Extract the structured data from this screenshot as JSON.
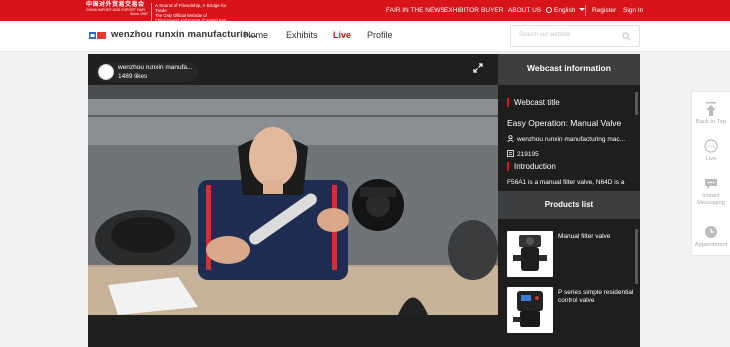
{
  "topbar": {
    "logo_zh": "中国对外贸易交易会",
    "logo_en": "CHINA IMPORT AND EXPORT FAIR",
    "logo_since": "Since 1957",
    "slogan_1": "A Sound of Friendship, A Bridge for Trade",
    "slogan_2": "The Only Official Website of",
    "slogan_3": "China Import and Export (Canton) Fair",
    "nav": [
      "FAIR IN THE NEWS",
      "EXHIBITOR",
      "BUYER",
      "ABOUT US"
    ],
    "language": "English",
    "register": "Register",
    "sign_in": "Sign In"
  },
  "navbar": {
    "company_name": "wenzhou runxin manufacturin...",
    "links": [
      "Home",
      "Exhibits",
      "Live",
      "Profile"
    ],
    "active": "Live",
    "search_placeholder": "Search our website"
  },
  "player": {
    "channel_name": "wenzhou runxin manufa...",
    "likes": "1489 likes"
  },
  "webcast": {
    "header": "Webcast information",
    "title_label": "Webcast title",
    "title": "Easy Operation: Manual Valve",
    "host": "wenzhou runxin manufacturing mac...",
    "id": "219195",
    "intro_label": "Introduction",
    "intro": "F56A1 is a manual filter valve, N64D is a"
  },
  "products": {
    "header": "Products list",
    "items": [
      {
        "name": "Manual filter valve"
      },
      {
        "name": "P series simple residential control valve"
      }
    ]
  },
  "sidebar": {
    "items": [
      {
        "label": "Back to Top"
      },
      {
        "label": "Live"
      },
      {
        "label": "Instant Messaging"
      },
      {
        "label": "Appointment"
      }
    ]
  },
  "colors": {
    "brand_red": "#d7141a",
    "panel_dark": "#1e1e1e",
    "panel_header": "#3d3e40"
  }
}
